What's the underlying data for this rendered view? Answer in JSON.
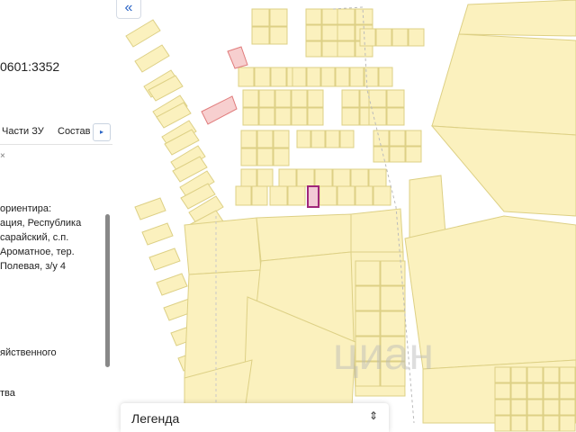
{
  "panel": {
    "cadastral_number_fragment": "0601:3352",
    "tabs": [
      "Части ЗУ",
      "Состав"
    ],
    "tab_next_glyph": "▸",
    "small_mark": "×",
    "address_lines": [
      "ориентира:",
      "ация, Республика",
      "сарайский, с.п.",
      "Ароматное, тер.",
      " Полевая, з/у 4"
    ],
    "text_fragment_1": "яйственного",
    "text_fragment_2": "тва"
  },
  "map": {
    "collapse_glyph": "«",
    "watermark": "циан",
    "legend_label": "Легенда",
    "legend_toggle_glyph": "⇕",
    "colors": {
      "parcel_fill": "#fbf1be",
      "parcel_stroke": "#ddd085",
      "selected_fill": "#f2c9d5",
      "selected_stroke": "#a0267a",
      "highlight_fill": "#f7cfcf",
      "highlight_stroke": "#e07b7b"
    }
  }
}
